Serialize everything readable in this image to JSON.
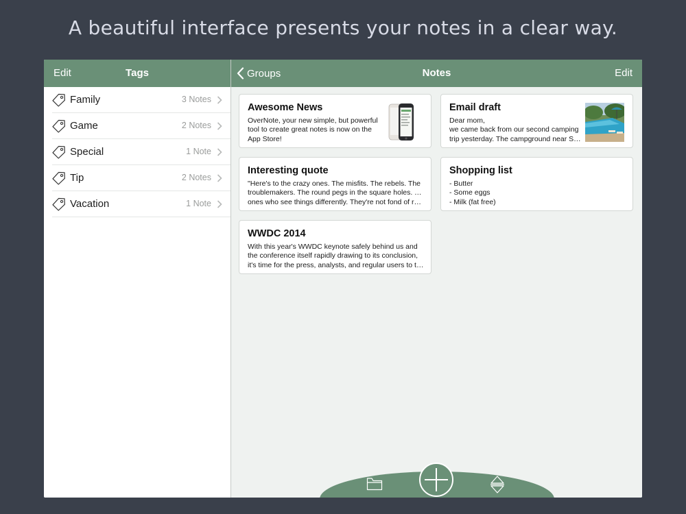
{
  "headline": "A beautiful interface presents your notes in a clear way.",
  "colors": {
    "background": "#3a404b",
    "accent": "#6a9077",
    "pane": "#eff2f0"
  },
  "tags_pane": {
    "edit_label": "Edit",
    "title": "Tags",
    "items": [
      {
        "name": "Family",
        "count": "3 Notes"
      },
      {
        "name": "Game",
        "count": "2 Notes"
      },
      {
        "name": "Special",
        "count": "1 Note"
      },
      {
        "name": "Tip",
        "count": "2 Notes"
      },
      {
        "name": "Vacation",
        "count": "1 Note"
      }
    ]
  },
  "notes_pane": {
    "back_label": "Groups",
    "title": "Notes",
    "edit_label": "Edit",
    "notes": [
      {
        "title": "Awesome News",
        "lines": [
          "OverNote, your new simple, but powerful",
          "tool to create great notes is now on the",
          "App Store!"
        ],
        "thumbnail": "iphone-image"
      },
      {
        "title": "Email draft",
        "lines": [
          "Dear mom,",
          "we came back from our second camping",
          "trip yesterday. The campground near Sa…"
        ],
        "thumbnail": "pool-image"
      },
      {
        "title": "Interesting quote",
        "lines": [
          "\"Here's to the crazy ones. The misfits. The rebels. The",
          "troublemakers. The round pegs in the square holes. The",
          "ones who see things differently. They're not fond of ru…"
        ]
      },
      {
        "title": "Shopping list",
        "lines": [
          "- Butter",
          "- Some eggs",
          "- Milk (fat free)"
        ]
      },
      {
        "title": "WWDC 2014",
        "lines": [
          "With this year's WWDC keynote safely behind us and",
          "the conference itself rapidly drawing to its conclusion,",
          "it's time for the press, analysts, and regular users to t…"
        ]
      }
    ]
  },
  "toolbar": {
    "icons": [
      "folder-icon",
      "plus-icon",
      "sort-icon"
    ]
  }
}
